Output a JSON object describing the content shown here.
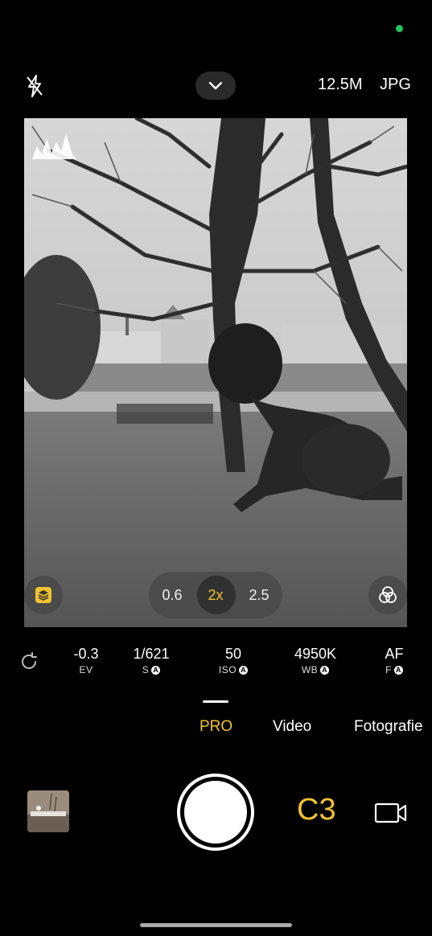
{
  "top_bar": {
    "flash_icon": "flash-off-icon",
    "resolution": "12.5M",
    "format": "JPG"
  },
  "viewfinder": {
    "zoom": {
      "options": [
        "0.6",
        "2x",
        "2.5"
      ],
      "active": "2x"
    }
  },
  "params": [
    {
      "value": "-0.3",
      "label": "EV",
      "auto": false
    },
    {
      "value": "1/621",
      "label": "S",
      "auto": true
    },
    {
      "value": "50",
      "label": "ISO",
      "auto": true
    },
    {
      "value": "4950K",
      "label": "WB",
      "auto": true
    },
    {
      "value": "AF",
      "label": "F",
      "auto": true
    }
  ],
  "auto_badge": "A",
  "modes": {
    "items": [
      "PRO",
      "Video",
      "Fotografie"
    ],
    "active": "PRO"
  },
  "bottom": {
    "custom_mode": "C3"
  },
  "colors": {
    "accent": "#f2c230",
    "status_dot": "#22c55e"
  }
}
